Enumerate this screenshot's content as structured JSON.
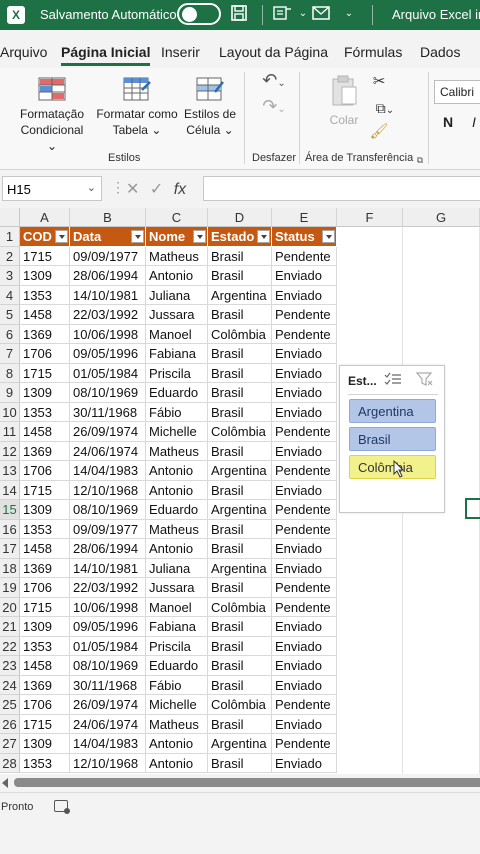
{
  "title_bar": {
    "autosave_label": "Salvamento Automático",
    "filename": "Arquivo Excel ins",
    "app_letter": "X"
  },
  "tabs": [
    "Arquivo",
    "Página Inicial",
    "Inserir",
    "Layout da Página",
    "Fórmulas",
    "Dados"
  ],
  "active_tab": "Página Inicial",
  "ribbon": {
    "cond_format_line1": "Formatação",
    "cond_format_line2": "Condicional",
    "format_table_line1": "Formatar como",
    "format_table_line2": "Tabela",
    "cell_styles_line1": "Estilos de",
    "cell_styles_line2": "Célula",
    "styles_group": "Estilos",
    "undo_group": "Desfazer",
    "paste_label": "Colar",
    "clipboard_group": "Área de Transferência",
    "font_name": "Calibri",
    "bold": "N",
    "italic": "I"
  },
  "formula_bar": {
    "name_box": "H15",
    "fx": "fx"
  },
  "columns": [
    "A",
    "B",
    "C",
    "D",
    "E",
    "F",
    "G"
  ],
  "table_headers": [
    "COD",
    "Data",
    "Nome",
    "Estado",
    "Status"
  ],
  "rows": [
    [
      "1715",
      "09/09/1977",
      "Matheus",
      "Brasil",
      "Pendente"
    ],
    [
      "1309",
      "28/06/1994",
      "Antonio",
      "Brasil",
      "Enviado"
    ],
    [
      "1353",
      "14/10/1981",
      "Juliana",
      "Argentina",
      "Enviado"
    ],
    [
      "1458",
      "22/03/1992",
      "Jussara",
      "Brasil",
      "Pendente"
    ],
    [
      "1369",
      "10/06/1998",
      "Manoel",
      "Colômbia",
      "Pendente"
    ],
    [
      "1706",
      "09/05/1996",
      "Fabiana",
      "Brasil",
      "Enviado"
    ],
    [
      "1715",
      "01/05/1984",
      "Priscila",
      "Brasil",
      "Enviado"
    ],
    [
      "1309",
      "08/10/1969",
      "Eduardo",
      "Brasil",
      "Enviado"
    ],
    [
      "1353",
      "30/11/1968",
      "Fábio",
      "Brasil",
      "Enviado"
    ],
    [
      "1458",
      "26/09/1974",
      "Michelle",
      "Colômbia",
      "Pendente"
    ],
    [
      "1369",
      "24/06/1974",
      "Matheus",
      "Brasil",
      "Enviado"
    ],
    [
      "1706",
      "14/04/1983",
      "Antonio",
      "Argentina",
      "Pendente"
    ],
    [
      "1715",
      "12/10/1968",
      "Antonio",
      "Brasil",
      "Enviado"
    ],
    [
      "1309",
      "08/10/1969",
      "Eduardo",
      "Argentina",
      "Pendente"
    ],
    [
      "1353",
      "09/09/1977",
      "Matheus",
      "Brasil",
      "Pendente"
    ],
    [
      "1458",
      "28/06/1994",
      "Antonio",
      "Brasil",
      "Enviado"
    ],
    [
      "1369",
      "14/10/1981",
      "Juliana",
      "Argentina",
      "Enviado"
    ],
    [
      "1706",
      "22/03/1992",
      "Jussara",
      "Brasil",
      "Pendente"
    ],
    [
      "1715",
      "10/06/1998",
      "Manoel",
      "Colômbia",
      "Pendente"
    ],
    [
      "1309",
      "09/05/1996",
      "Fabiana",
      "Brasil",
      "Enviado"
    ],
    [
      "1353",
      "01/05/1984",
      "Priscila",
      "Brasil",
      "Enviado"
    ],
    [
      "1458",
      "08/10/1969",
      "Eduardo",
      "Brasil",
      "Enviado"
    ],
    [
      "1369",
      "30/11/1968",
      "Fábio",
      "Brasil",
      "Enviado"
    ],
    [
      "1706",
      "26/09/1974",
      "Michelle",
      "Colômbia",
      "Pendente"
    ],
    [
      "1715",
      "24/06/1974",
      "Matheus",
      "Brasil",
      "Enviado"
    ],
    [
      "1309",
      "14/04/1983",
      "Antonio",
      "Argentina",
      "Pendente"
    ],
    [
      "1353",
      "12/10/1968",
      "Antonio",
      "Brasil",
      "Enviado"
    ]
  ],
  "row_numbers": [
    "1",
    "2",
    "3",
    "4",
    "5",
    "6",
    "7",
    "8",
    "9",
    "10",
    "11",
    "12",
    "13",
    "14",
    "15",
    "16",
    "17",
    "18",
    "19",
    "20",
    "21",
    "22",
    "23",
    "24",
    "25",
    "26",
    "27",
    "28"
  ],
  "selected_row": "15",
  "slicer": {
    "title": "Est...",
    "items": [
      "Argentina",
      "Brasil",
      "Colômbia"
    ]
  },
  "status": {
    "ready": "Pronto"
  },
  "colors": {
    "excel_green": "#1e7145",
    "table_header": "#c65911",
    "slicer_selected": "#b4c6e7",
    "slicer_hover": "#f2f28c"
  }
}
